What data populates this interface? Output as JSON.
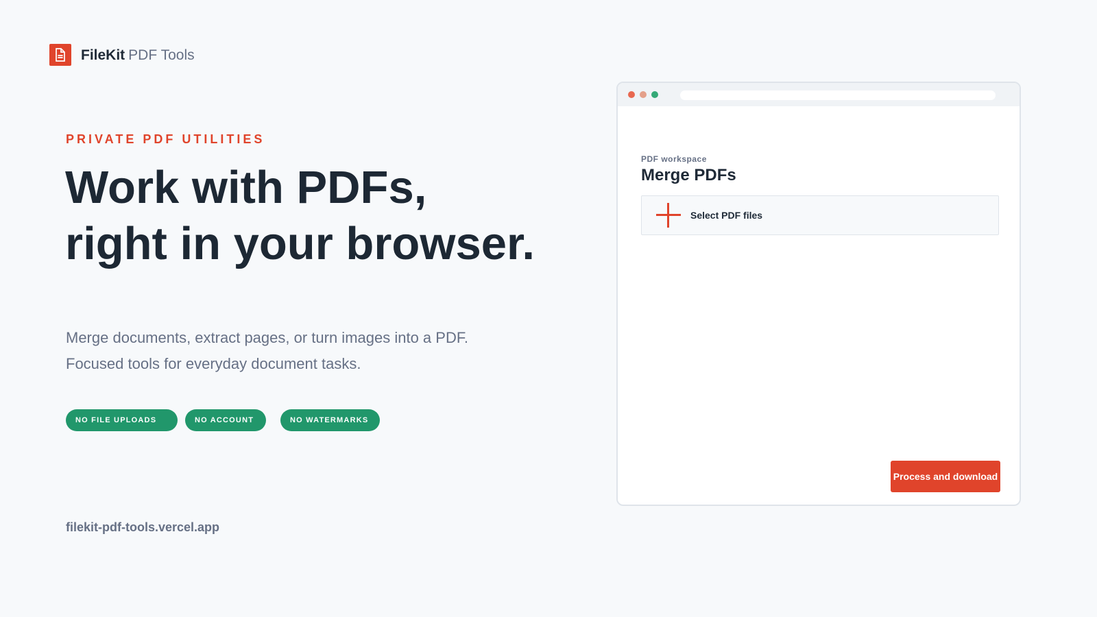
{
  "header": {
    "brand": "FileKit",
    "product": "PDF Tools"
  },
  "hero": {
    "eyebrow": "PRIVATE PDF UTILITIES",
    "title_line_1": "Work with PDFs,",
    "title_line_2": "right in your browser.",
    "description_line_1": "Merge documents, extract pages, or turn images into a PDF.",
    "description_line_2": "Focused tools for everyday document tasks.",
    "badges": [
      "NO FILE UPLOADS",
      "NO ACCOUNT",
      "NO WATERMARKS"
    ],
    "site": "filekit-pdf-tools.vercel.app"
  },
  "preview": {
    "workspace_label": "PDF workspace",
    "title": "Merge PDFs",
    "select_files_label": "Select PDF files",
    "process_button_label": "Process and download"
  },
  "icons": {
    "logo": "document-icon",
    "select_files": "plus-icon"
  },
  "colors": {
    "accent": "#e0442b",
    "badge": "#21976b",
    "text": "#1f2a37",
    "muted": "#667085",
    "background": "#f7f9fb"
  }
}
